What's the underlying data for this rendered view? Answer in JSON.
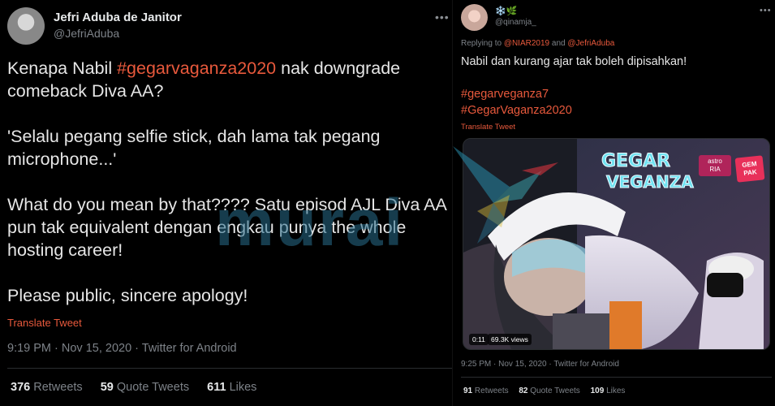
{
  "left_tweet": {
    "display_name": "Jefri Aduba de Janitor",
    "handle": "@JefriAduba",
    "paragraphs": [
      {
        "pre": "Kenapa Nabil ",
        "tag": "#gegarvaganza2020",
        "post": " nak downgrade comeback Diva AA?"
      },
      {
        "text": "'Selalu pegang selfie stick, dah lama tak pegang microphone...'"
      },
      {
        "text": "What do you mean by that???? Satu episod AJL Diva AA pun tak equivalent dengan engkau punya the whole hosting career!"
      },
      {
        "text": "Please public, sincere apology!"
      }
    ],
    "translate_label": "Translate Tweet",
    "meta": "9:19 PM · Nov 15, 2020 · Twitter for Android",
    "stats": {
      "retweets_count": "376",
      "retweets_label": "Retweets",
      "quotes_count": "59",
      "quotes_label": "Quote Tweets",
      "likes_count": "611",
      "likes_label": "Likes"
    }
  },
  "right_tweet": {
    "display_name": "❄️🌿",
    "handle": "@qinamja_",
    "reply_prefix": "Replying to",
    "mention_1": "@NIAR2019",
    "reply_and": "and",
    "mention_2": "@JefriAduba",
    "body": "Nabil dan kurang ajar tak boleh dipisahkan!",
    "tag_1": "#gegarveganza7",
    "tag_2": "#GegarVaganza2020",
    "translate_label": "Translate Tweet",
    "media": {
      "logo_line_1": "GEGAR",
      "logo_line_2": "VEGANZA",
      "astro_badge": "astro",
      "ria_badge": "RIA",
      "gempak_badge": "GEM PAK",
      "duration": "0:11",
      "views": "69.3K views"
    },
    "meta": "9:25 PM · Nov 15, 2020 · Twitter for Android",
    "stats": {
      "retweets_count": "91",
      "retweets_label": "Retweets",
      "quotes_count": "82",
      "quotes_label": "Quote Tweets",
      "likes_count": "109",
      "likes_label": "Likes"
    }
  },
  "watermark": {
    "text": "murai"
  },
  "colors": {
    "accent": "#e8593c",
    "background": "#000000",
    "muted": "#7d8288",
    "watermark": "#286e8c"
  },
  "icons": [
    "more-icon",
    "avatar",
    "hummingbird-logo"
  ]
}
